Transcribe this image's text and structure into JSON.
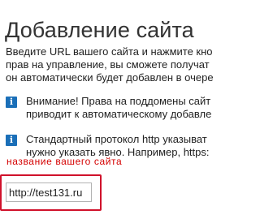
{
  "page": {
    "title": "Добавление сайта"
  },
  "intro": {
    "lines": [
      "Введите URL вашего сайта и нажмите кно",
      "прав на управление, вы сможете получат",
      "он автоматически будет добавлен в очере"
    ]
  },
  "notices": [
    {
      "icon": "info-icon",
      "lines": [
        "Внимание! Права на поддомены сайт",
        "приводит к автоматическому добавле"
      ]
    },
    {
      "icon": "info-icon",
      "lines": [
        "Стандартный протокол http указыват",
        "нужно указать явно. Например, https:"
      ]
    }
  ],
  "annotation": {
    "label": "название вашего сайта"
  },
  "url_field": {
    "value": "http://test131.ru"
  },
  "colors": {
    "info_icon": "#1a6fb8",
    "annotation": "#d40000",
    "highlight_border": "#d0112b"
  }
}
